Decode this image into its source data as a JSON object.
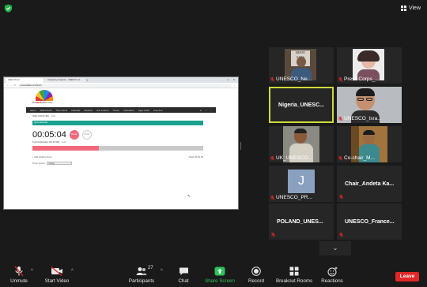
{
  "top": {
    "view_label": "View"
  },
  "browser": {
    "tab1": "Online Timer",
    "tab2": "Outposting Outposts - UNESCO Jot...",
    "url": "timeanddate.com/timer/",
    "logo_prefix": "time",
    "logo_mid": "and",
    "logo_suffix": "date.com",
    "nav": [
      "Home",
      "World Clock",
      "Time Zones",
      "Calendar",
      "Weather",
      "Sun & Moon",
      "Timers",
      "Calculators",
      "Apps & API",
      "Free Fun"
    ],
    "timer_row_label": "ISSL (00:01:30)",
    "edit_label": "Edit",
    "bar_label": "(time selected)",
    "clock_value": "00:05:04",
    "pause_label": "Pause",
    "reset_label": "Reset",
    "second_label": "Formal Debate (00:15:00)",
    "progress_fraction": 0.39,
    "add_timer_label": "+  Add another timer",
    "total_label": "Total: 00:16:00",
    "sound_label": "Timer sound",
    "sound_value": "Analog"
  },
  "participants": [
    {
      "name": "UNESCO_Ne...",
      "muted": true
    },
    {
      "name": "Press Corps_...",
      "muted": true
    },
    {
      "name": "Nigeria_UNESC...",
      "muted": false
    },
    {
      "name": "UNESCO_Isra...",
      "muted": true
    },
    {
      "name": "UK_UNESCO...",
      "muted": true
    },
    {
      "name": "Co-chair_M...",
      "muted": true
    },
    {
      "name": "UNESCO_PR...",
      "muted": true,
      "initial": "J"
    },
    {
      "name": "Chair_Andeta Ka...",
      "muted": false
    },
    {
      "name": "POLAND_UNES...",
      "muted": false
    },
    {
      "name": "UNESCO_France...",
      "muted": false
    }
  ],
  "toolbar": {
    "unmute": "Unmute",
    "start_video": "Start Video",
    "participants": "Participants",
    "participants_count": "27",
    "chat": "Chat",
    "share_screen": "Share Screen",
    "record": "Record",
    "breakout": "Breakout Rooms",
    "reactions": "Reactions",
    "leave": "Leave"
  },
  "colors": {
    "accent_green": "#2fc15b",
    "leave_red": "#e02828",
    "active_border": "#cddc39",
    "timer_teal": "#1aa190",
    "timer_pink": "#f06a7c"
  }
}
